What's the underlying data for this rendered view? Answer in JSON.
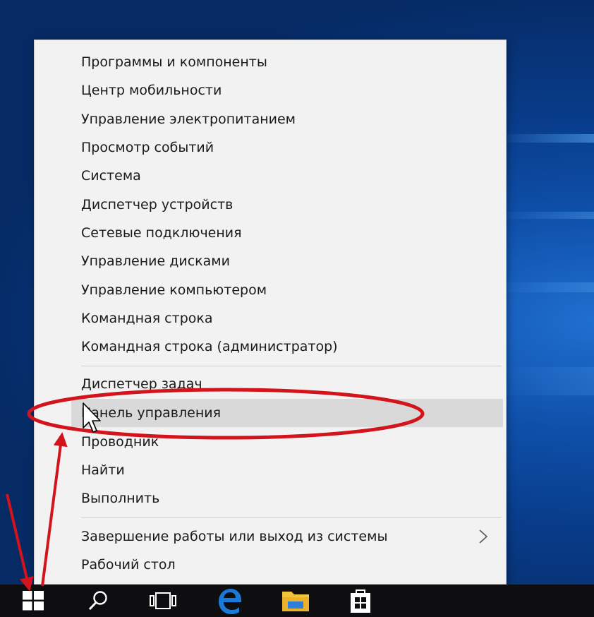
{
  "menu": {
    "groups": [
      {
        "items": [
          {
            "label": "Программы и компоненты"
          },
          {
            "label": "Центр мобильности"
          },
          {
            "label": "Управление электропитанием"
          },
          {
            "label": "Просмотр событий"
          },
          {
            "label": "Система"
          },
          {
            "label": "Диспетчер устройств"
          },
          {
            "label": "Сетевые подключения"
          },
          {
            "label": "Управление дисками"
          },
          {
            "label": "Управление компьютером"
          },
          {
            "label": "Командная строка"
          },
          {
            "label": "Командная строка (администратор)"
          }
        ]
      },
      {
        "items": [
          {
            "label": "Диспетчер задач"
          },
          {
            "label": "Панель управления"
          },
          {
            "label": "Проводник"
          },
          {
            "label": "Найти"
          },
          {
            "label": "Выполнить"
          }
        ]
      },
      {
        "items": [
          {
            "label": "Завершение работы или выход из системы"
          },
          {
            "label": "Рабочий стол"
          }
        ]
      }
    ],
    "highlighted_item": "Панель управления",
    "submenu_icon": "chevron-right-icon"
  },
  "taskbar": {
    "buttons": [
      {
        "icon": "windows-start-icon"
      },
      {
        "icon": "search-icon"
      },
      {
        "icon": "task-view-icon"
      },
      {
        "icon": "edge-browser-icon"
      },
      {
        "icon": "file-explorer-icon"
      },
      {
        "icon": "store-icon"
      }
    ]
  },
  "colors": {
    "menu_bg": "#f2f2f2",
    "hover_bg": "#d9d9d9",
    "annotation_red": "#d3141c",
    "taskbar_bg": "#0e0e10",
    "edge_blue": "#1a7ad9",
    "folder_yellow": "#f2c437"
  }
}
